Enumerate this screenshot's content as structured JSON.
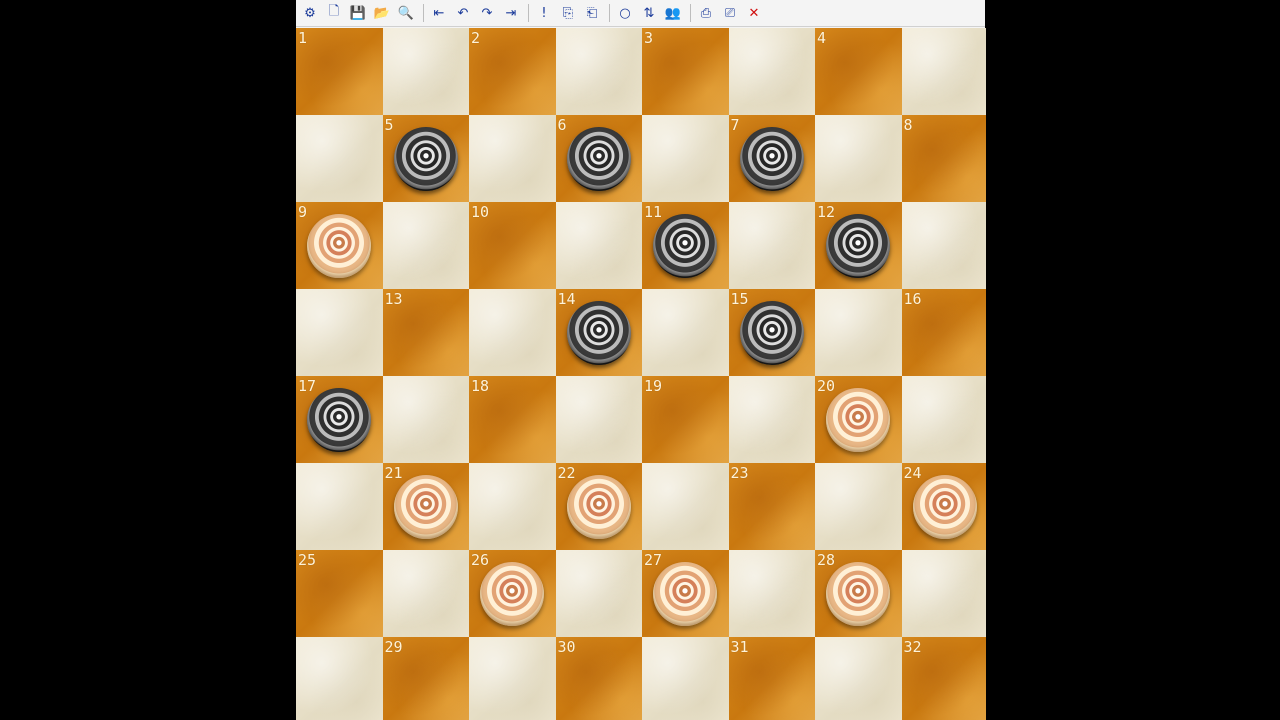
{
  "toolbar": {
    "buttons": [
      {
        "name": "setup-icon",
        "glyph": "⚙"
      },
      {
        "name": "new-icon",
        "glyph": "🗋"
      },
      {
        "name": "save-icon",
        "glyph": "💾"
      },
      {
        "name": "open-icon",
        "glyph": "📂"
      },
      {
        "name": "search-icon",
        "glyph": "🔍"
      },
      {
        "name": "sep"
      },
      {
        "name": "first-move-icon",
        "glyph": "⇤"
      },
      {
        "name": "undo-icon",
        "glyph": "↶"
      },
      {
        "name": "redo-icon",
        "glyph": "↷"
      },
      {
        "name": "last-move-icon",
        "glyph": "⇥"
      },
      {
        "name": "sep"
      },
      {
        "name": "exclaim-icon",
        "glyph": "!"
      },
      {
        "name": "copy-board-icon",
        "glyph": "⎘"
      },
      {
        "name": "paste-board-icon",
        "glyph": "⎗"
      },
      {
        "name": "sep"
      },
      {
        "name": "circle-icon",
        "glyph": "○"
      },
      {
        "name": "flip-icon",
        "glyph": "⇅"
      },
      {
        "name": "players-icon",
        "glyph": "👥"
      },
      {
        "name": "sep"
      },
      {
        "name": "export-icon",
        "glyph": "⎙"
      },
      {
        "name": "import-icon",
        "glyph": "⎚"
      },
      {
        "name": "close-icon",
        "glyph": "✕",
        "color": "#d01010"
      }
    ]
  },
  "board": {
    "colors": {
      "light": "#ece4cd",
      "dark": "#d28418"
    },
    "squares": [
      {
        "n": "1",
        "piece": ""
      },
      {
        "n": "2",
        "piece": ""
      },
      {
        "n": "3",
        "piece": ""
      },
      {
        "n": "4",
        "piece": ""
      },
      {
        "n": "5",
        "piece": "black"
      },
      {
        "n": "6",
        "piece": "black"
      },
      {
        "n": "7",
        "piece": "black"
      },
      {
        "n": "8",
        "piece": ""
      },
      {
        "n": "9",
        "piece": "white"
      },
      {
        "n": "10",
        "piece": ""
      },
      {
        "n": "11",
        "piece": "black"
      },
      {
        "n": "12",
        "piece": "black"
      },
      {
        "n": "13",
        "piece": ""
      },
      {
        "n": "14",
        "piece": "black"
      },
      {
        "n": "15",
        "piece": "black"
      },
      {
        "n": "16",
        "piece": ""
      },
      {
        "n": "17",
        "piece": "black"
      },
      {
        "n": "18",
        "piece": ""
      },
      {
        "n": "19",
        "piece": ""
      },
      {
        "n": "20",
        "piece": "white"
      },
      {
        "n": "21",
        "piece": "white"
      },
      {
        "n": "22",
        "piece": "white"
      },
      {
        "n": "23",
        "piece": ""
      },
      {
        "n": "24",
        "piece": "white"
      },
      {
        "n": "25",
        "piece": ""
      },
      {
        "n": "26",
        "piece": "white"
      },
      {
        "n": "27",
        "piece": "white"
      },
      {
        "n": "28",
        "piece": "white"
      },
      {
        "n": "29",
        "piece": ""
      },
      {
        "n": "30",
        "piece": ""
      },
      {
        "n": "31",
        "piece": ""
      },
      {
        "n": "32",
        "piece": ""
      }
    ]
  }
}
